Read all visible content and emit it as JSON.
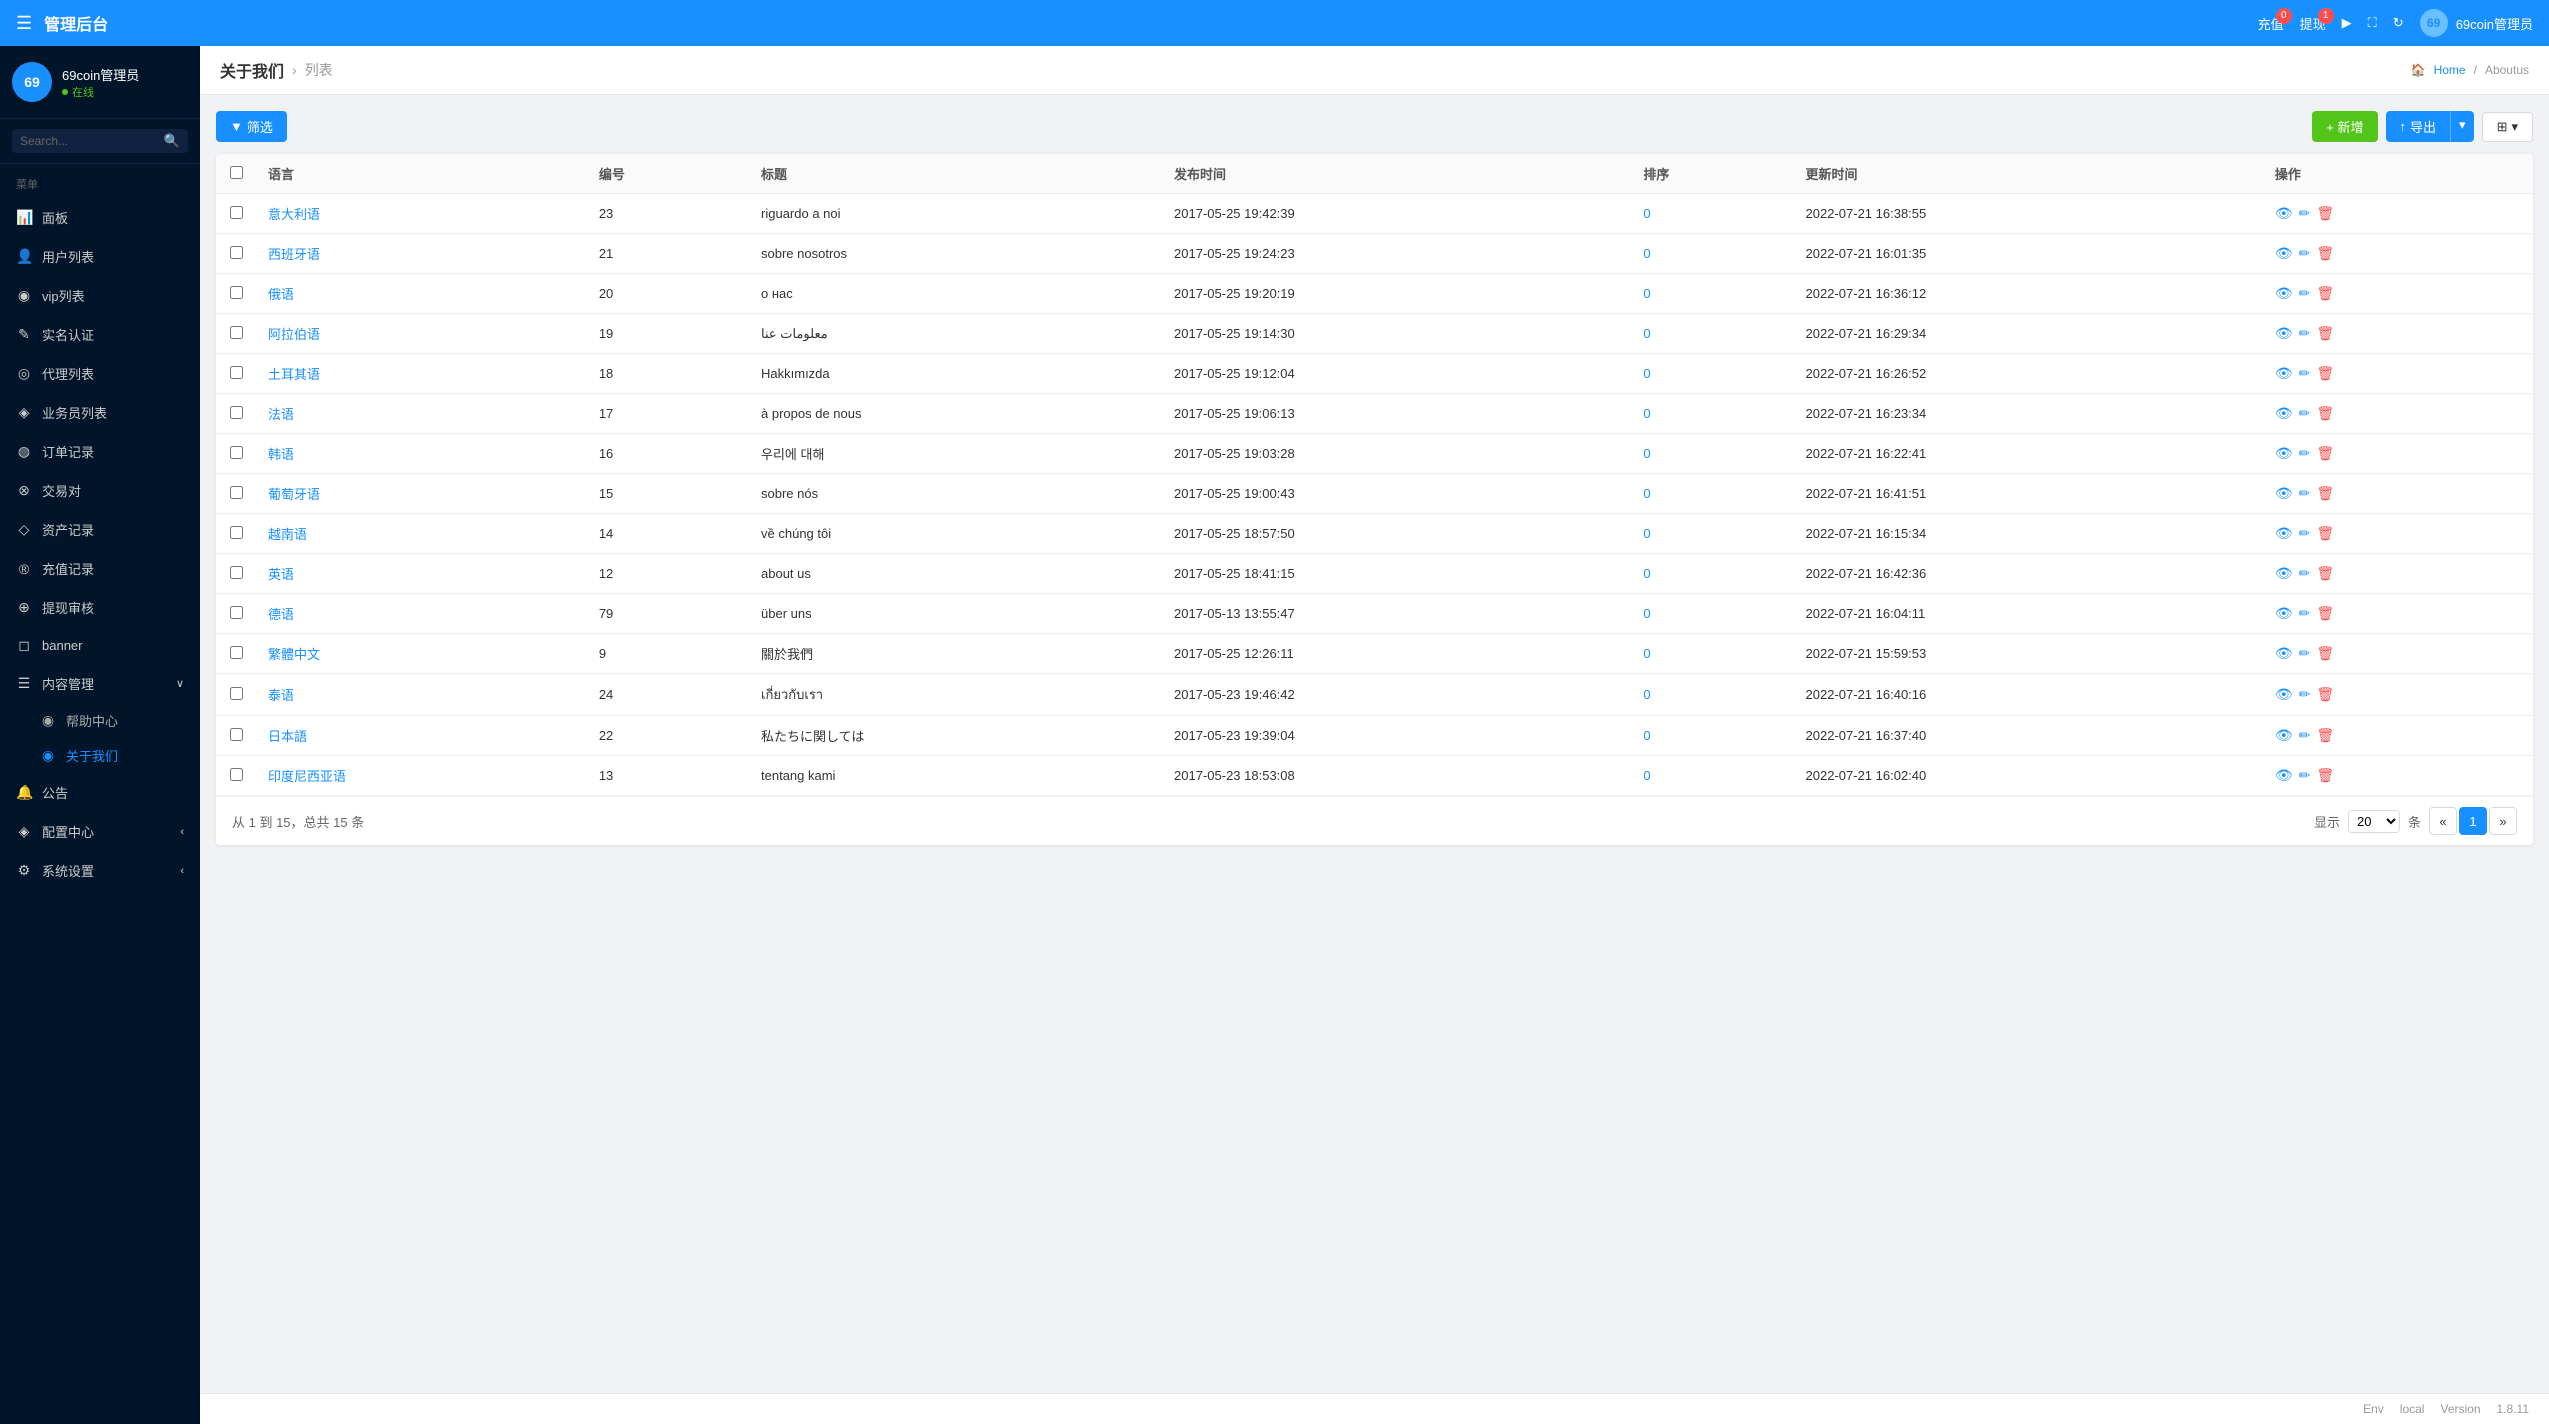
{
  "header": {
    "title": "管理后台",
    "menu_icon": "☰",
    "recharge_label": "充值",
    "recharge_badge": "0",
    "withdraw_label": "提现",
    "withdraw_badge": "1",
    "play_icon": "▶",
    "fullscreen_icon": "⛶",
    "refresh_icon": "↻",
    "admin_label": "69coin管理员"
  },
  "sidebar": {
    "user_name": "69coin管理员",
    "user_status": "在线",
    "search_placeholder": "Search...",
    "menu_label": "菜单",
    "items": [
      {
        "id": "dashboard",
        "icon": "📊",
        "label": "面板"
      },
      {
        "id": "users",
        "icon": "👤",
        "label": "用户列表"
      },
      {
        "id": "vip",
        "icon": "◉",
        "label": "vip列表"
      },
      {
        "id": "realname",
        "icon": "✎",
        "label": "实名认证"
      },
      {
        "id": "agents",
        "icon": "◎",
        "label": "代理列表"
      },
      {
        "id": "staff",
        "icon": "◈",
        "label": "业务员列表"
      },
      {
        "id": "orders",
        "icon": "◍",
        "label": "订单记录"
      },
      {
        "id": "trades",
        "icon": "⊗",
        "label": "交易对"
      },
      {
        "id": "assets",
        "icon": "◇",
        "label": "资产记录"
      },
      {
        "id": "recharge",
        "icon": "®",
        "label": "充值记录"
      },
      {
        "id": "withdraw_review",
        "icon": "⊕",
        "label": "提现审核"
      },
      {
        "id": "banner",
        "icon": "◻",
        "label": "banner"
      },
      {
        "id": "content_mgmt",
        "icon": "☰",
        "label": "内容管理",
        "has_arrow": true,
        "expanded": true
      },
      {
        "id": "help",
        "icon": "◉",
        "label": "帮助中心",
        "is_sub": true
      },
      {
        "id": "about_us",
        "icon": "◉",
        "label": "关于我们",
        "is_sub": true,
        "active": true
      },
      {
        "id": "notice",
        "icon": "🔔",
        "label": "公告"
      },
      {
        "id": "config",
        "icon": "◈",
        "label": "配置中心",
        "has_arrow": true
      },
      {
        "id": "system",
        "icon": "⚙",
        "label": "系统设置",
        "has_arrow": true
      }
    ]
  },
  "breadcrumb": {
    "title": "关于我们",
    "sub": "列表",
    "home": "Home",
    "current": "Aboutus"
  },
  "toolbar": {
    "filter_label": "筛选",
    "add_label": "+ 新增",
    "export_label": "导出",
    "layout_label": "⊞"
  },
  "table": {
    "columns": [
      "",
      "语言",
      "编号",
      "标题",
      "发布时间",
      "排序",
      "更新时间",
      "操作"
    ],
    "rows": [
      {
        "lang": "意大利语",
        "id": "23",
        "title": "riguardo a noi",
        "publish_time": "2017-05-25 19:42:39",
        "sort": "0",
        "update_time": "2022-07-21 16:38:55"
      },
      {
        "lang": "西班牙语",
        "id": "21",
        "title": "sobre nosotros",
        "publish_time": "2017-05-25 19:24:23",
        "sort": "0",
        "update_time": "2022-07-21 16:01:35"
      },
      {
        "lang": "俄语",
        "id": "20",
        "title": "о нас",
        "publish_time": "2017-05-25 19:20:19",
        "sort": "0",
        "update_time": "2022-07-21 16:36:12"
      },
      {
        "lang": "阿拉伯语",
        "id": "19",
        "title": "معلومات عنا",
        "publish_time": "2017-05-25 19:14:30",
        "sort": "0",
        "update_time": "2022-07-21 16:29:34"
      },
      {
        "lang": "土耳其语",
        "id": "18",
        "title": "Hakkımızda",
        "publish_time": "2017-05-25 19:12:04",
        "sort": "0",
        "update_time": "2022-07-21 16:26:52"
      },
      {
        "lang": "法语",
        "id": "17",
        "title": "à propos de nous",
        "publish_time": "2017-05-25 19:06:13",
        "sort": "0",
        "update_time": "2022-07-21 16:23:34"
      },
      {
        "lang": "韩语",
        "id": "16",
        "title": "우리에 대해",
        "publish_time": "2017-05-25 19:03:28",
        "sort": "0",
        "update_time": "2022-07-21 16:22:41"
      },
      {
        "lang": "葡萄牙语",
        "id": "15",
        "title": "sobre nós",
        "publish_time": "2017-05-25 19:00:43",
        "sort": "0",
        "update_time": "2022-07-21 16:41:51"
      },
      {
        "lang": "越南语",
        "id": "14",
        "title": "về chúng tôi",
        "publish_time": "2017-05-25 18:57:50",
        "sort": "0",
        "update_time": "2022-07-21 16:15:34"
      },
      {
        "lang": "英语",
        "id": "12",
        "title": "about us",
        "publish_time": "2017-05-25 18:41:15",
        "sort": "0",
        "update_time": "2022-07-21 16:42:36"
      },
      {
        "lang": "德语",
        "id": "79",
        "title": "über uns",
        "publish_time": "2017-05-13 13:55:47",
        "sort": "0",
        "update_time": "2022-07-21 16:04:11"
      },
      {
        "lang": "繁體中文",
        "id": "9",
        "title": "關於我們",
        "publish_time": "2017-05-25 12:26:11",
        "sort": "0",
        "update_time": "2022-07-21 15:59:53"
      },
      {
        "lang": "泰语",
        "id": "24",
        "title": "เกี่ยวกับเรา",
        "publish_time": "2017-05-23 19:46:42",
        "sort": "0",
        "update_time": "2022-07-21 16:40:16"
      },
      {
        "lang": "日本語",
        "id": "22",
        "title": "私たちに関しては",
        "publish_time": "2017-05-23 19:39:04",
        "sort": "0",
        "update_time": "2022-07-21 16:37:40"
      },
      {
        "lang": "印度尼西亚语",
        "id": "13",
        "title": "tentang kami",
        "publish_time": "2017-05-23 18:53:08",
        "sort": "0",
        "update_time": "2022-07-21 16:02:40"
      }
    ]
  },
  "pagination": {
    "info": "从 1 到 15，总共 15 条",
    "display_label": "显示",
    "per_page": "20",
    "per_page_suffix": "条",
    "prev": "«",
    "page1": "1",
    "next": "»"
  },
  "footer": {
    "env_label": "Env",
    "env_value": "local",
    "version_label": "Version",
    "version_value": "1.8.11"
  },
  "colors": {
    "primary": "#1890ff",
    "success": "#52c41a",
    "danger": "#ff4d4f",
    "sidebar_bg": "#001529"
  }
}
